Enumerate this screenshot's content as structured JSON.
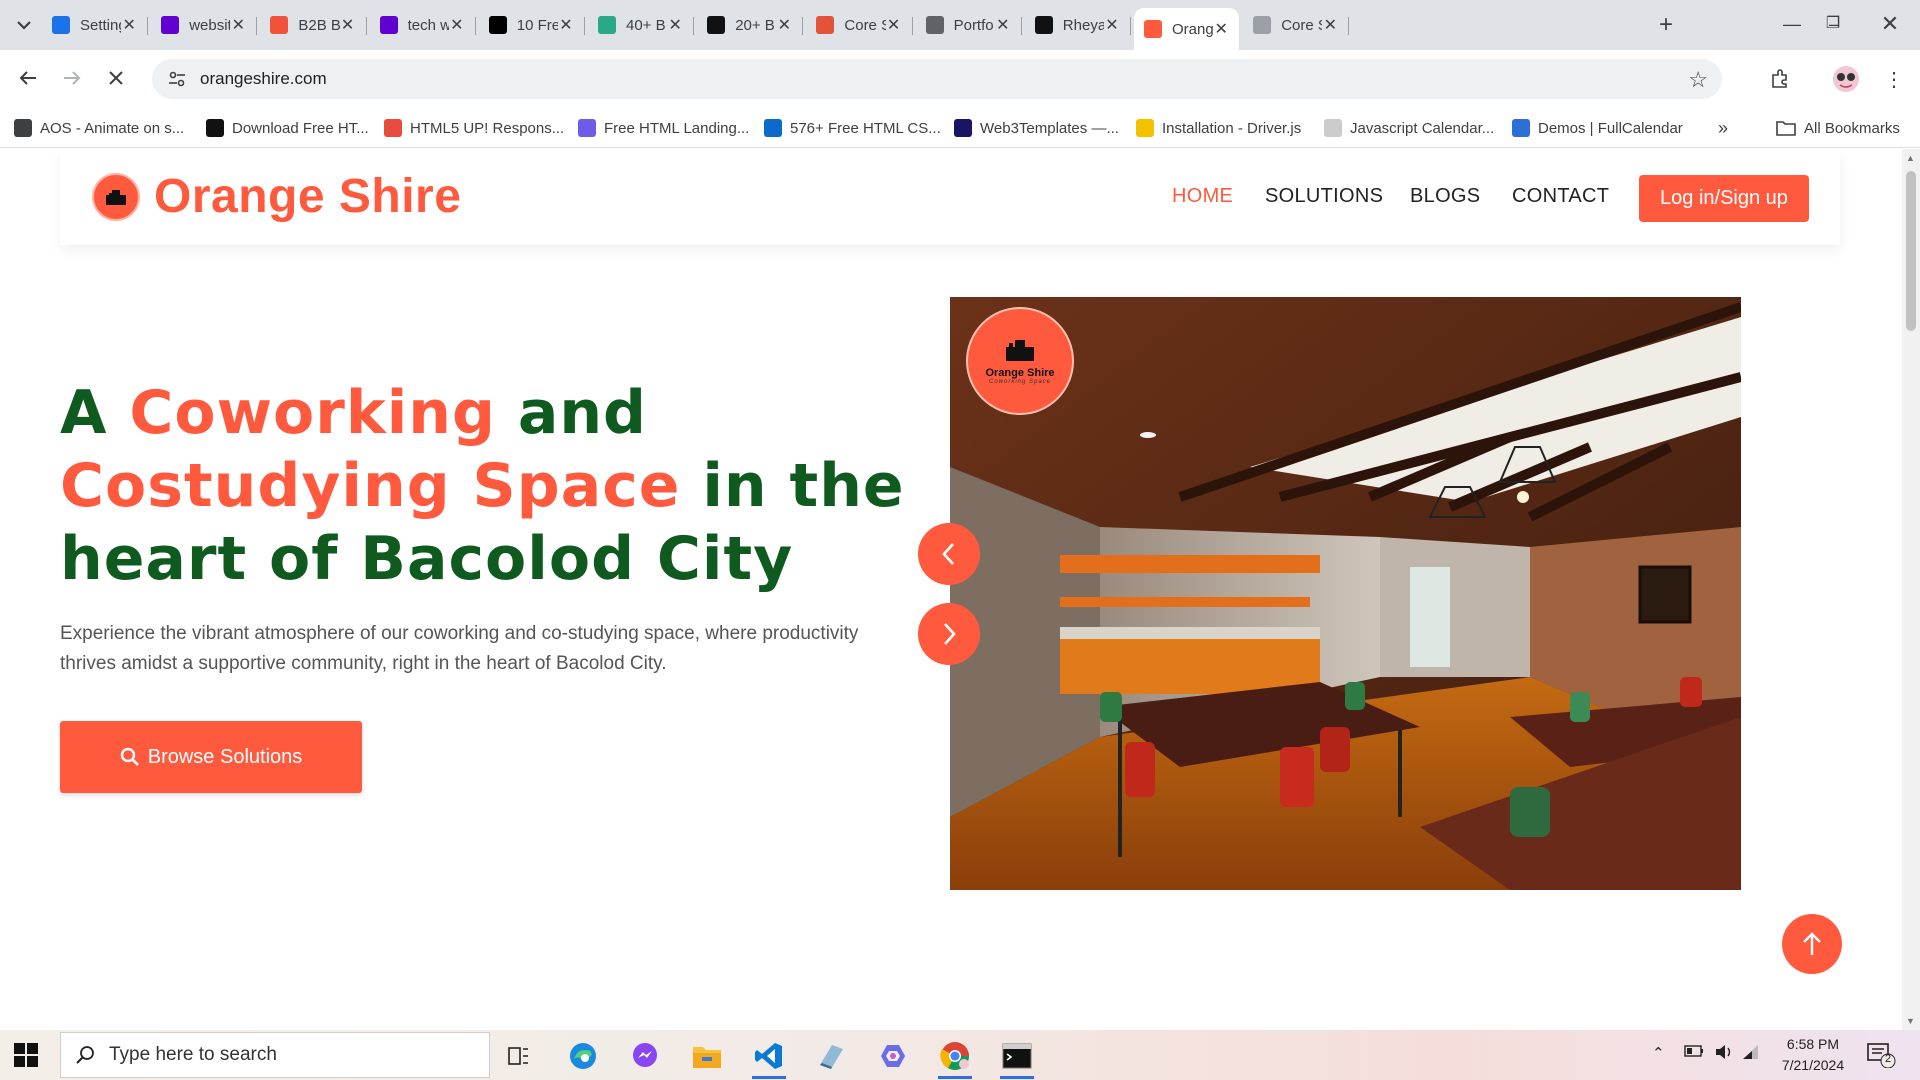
{
  "browser": {
    "tabs": [
      {
        "title": "Setting",
        "icon": "gear-icon",
        "color": "#1a73e8"
      },
      {
        "title": "websit",
        "icon": "yahoo-icon",
        "color": "#6001d2"
      },
      {
        "title": "B2B Bl",
        "icon": "99d-icon",
        "color": "#f0533a"
      },
      {
        "title": "tech w",
        "icon": "yahoo-icon",
        "color": "#6001d2"
      },
      {
        "title": "10 Fre",
        "icon": "dev-icon",
        "color": "#000000"
      },
      {
        "title": "40+ B",
        "icon": "bird-icon",
        "color": "#2aa88a"
      },
      {
        "title": "20+ B",
        "icon": "n-icon",
        "color": "#111111"
      },
      {
        "title": "Core S",
        "icon": "target-icon",
        "color": "#e2533a"
      },
      {
        "title": "Portfo",
        "icon": "globe-icon",
        "color": "#5f6368"
      },
      {
        "title": "Rheya",
        "icon": "github-icon",
        "color": "#111111"
      },
      {
        "title": "Orang",
        "icon": "orange-shire-icon",
        "color": "#ff5a3d"
      },
      {
        "title": "Core S",
        "icon": "target-icon",
        "color": "#9aa0a6"
      }
    ],
    "url": "orangeshire.com",
    "bookmarks": [
      {
        "label": "AOS - Animate on s...",
        "icon": "globe-icon",
        "color": "#3c4043"
      },
      {
        "label": "Download Free HT...",
        "icon": "h-icon",
        "color": "#111111"
      },
      {
        "label": "HTML5 UP! Respons...",
        "icon": "html5up-icon",
        "color": "#e84c3d"
      },
      {
        "label": "Free HTML Landing...",
        "icon": "landing-icon",
        "color": "#6d5ce8"
      },
      {
        "label": "576+ Free HTML CS...",
        "icon": "tm-icon",
        "color": "#0b6bcb"
      },
      {
        "label": "Web3Templates —...",
        "icon": "w3t-icon",
        "color": "#1b1464"
      },
      {
        "label": "Installation - Driver.js",
        "icon": "driverjs-icon",
        "color": "#f2c200"
      },
      {
        "label": "Javascript Calendar...",
        "icon": "calendar-icon",
        "color": "#cccccc"
      },
      {
        "label": "Demos | FullCalendar",
        "icon": "fullcalendar-icon",
        "color": "#2c6fd6"
      }
    ],
    "all_bookmarks": "All Bookmarks"
  },
  "site": {
    "brand": "Orange Shire",
    "nav": {
      "home": "HOME",
      "solutions": "SOLUTIONS",
      "blogs": "BLOGS",
      "contact": "CONTACT",
      "login": "Log in/Sign up"
    },
    "hero": {
      "t1": "A ",
      "t2": "Coworking",
      "t3": " and ",
      "t4": "Costudying Space",
      "t5": " in the heart of Bacolod City",
      "description": "Experience the vibrant atmosphere of our coworking and co-studying space, where productivity thrives amidst a supportive community, right in the heart of Bacolod City.",
      "cta": "Browse Solutions"
    },
    "image_logo": {
      "name": "Orange Shire",
      "tagline": "Coworking Space"
    }
  },
  "taskbar": {
    "search_placeholder": "Type here to search",
    "time": "6:58 PM",
    "date": "7/21/2024",
    "notifications": "2"
  },
  "colors": {
    "accent": "#ff5a3d",
    "heading_green": "#0f5a1e",
    "text_gray": "#555555"
  }
}
